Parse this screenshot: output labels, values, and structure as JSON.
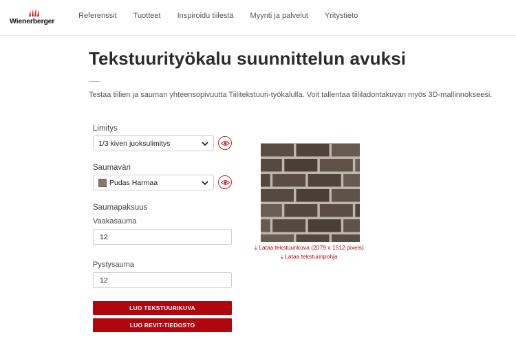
{
  "brand": {
    "name": "Wienerberger",
    "accent": "#b0070f"
  },
  "nav": [
    {
      "label": "Referenssit"
    },
    {
      "label": "Tuotteet"
    },
    {
      "label": "Inspiroidu tiilestä"
    },
    {
      "label": "Myynti ja palvelut"
    },
    {
      "label": "Yritystieto"
    }
  ],
  "page": {
    "title": "Tekstuurityökalu suunnittelun avuksi",
    "intro": "Testaa tiilien ja sauman yhteensopivuutta Tiilitekstuuri-työkalulla. Voit tallentaa tiililadontakuvan myös 3D-mallinnokseesi."
  },
  "form": {
    "limitys": {
      "label": "Limitys",
      "value": "1/3 kiven juoksulimitys",
      "icon": "eye-icon"
    },
    "saumavari": {
      "label": "Saumaväri",
      "value": "Pudas Harmaa",
      "icon": "eye-icon"
    },
    "saumapaksuus": {
      "label": "Saumapaksuus"
    },
    "vaakasauma": {
      "label": "Vaakasauma",
      "value": "12"
    },
    "pystysauma": {
      "label": "Pystysauma",
      "value": "12"
    }
  },
  "buttons": {
    "create_texture": "LUO TEKSTUURIKUVA",
    "create_revit": "LUO REVIT-TIEDOSTO"
  },
  "downloads": {
    "texture_image": "Lataa tekstuurikuva (2079 x 1512 pixels)",
    "texture_base": "Lataa tekstuuripohja",
    "icon": "download-icon"
  }
}
